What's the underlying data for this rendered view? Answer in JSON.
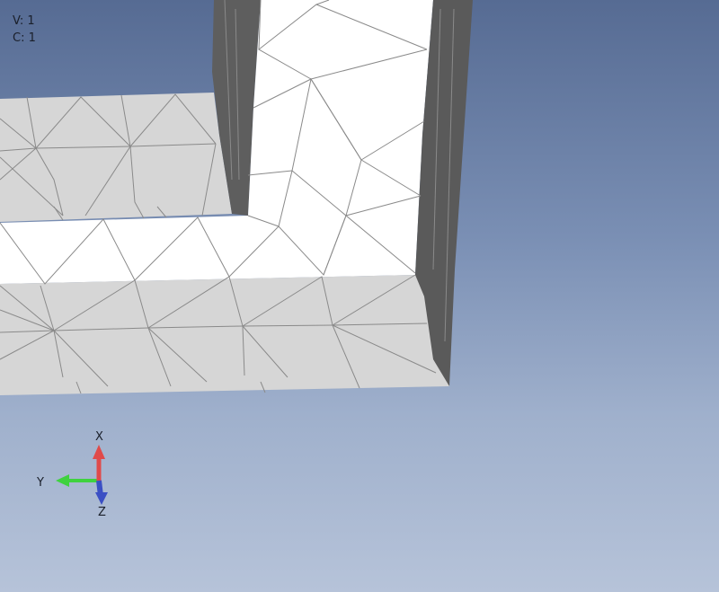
{
  "counters": {
    "vertices": "V: 1",
    "cells": "C: 1"
  },
  "triad": {
    "x_label": "X",
    "y_label": "Y",
    "z_label": "Z",
    "x_color": "#e04a4a",
    "y_color": "#3fd23f",
    "z_color": "#3b4fc4"
  },
  "colors": {
    "top_face": "#ffffff",
    "front_face": "#d6d6d6",
    "side_face": "#5a5a5a",
    "mesh_line": "#8a8a8a"
  }
}
